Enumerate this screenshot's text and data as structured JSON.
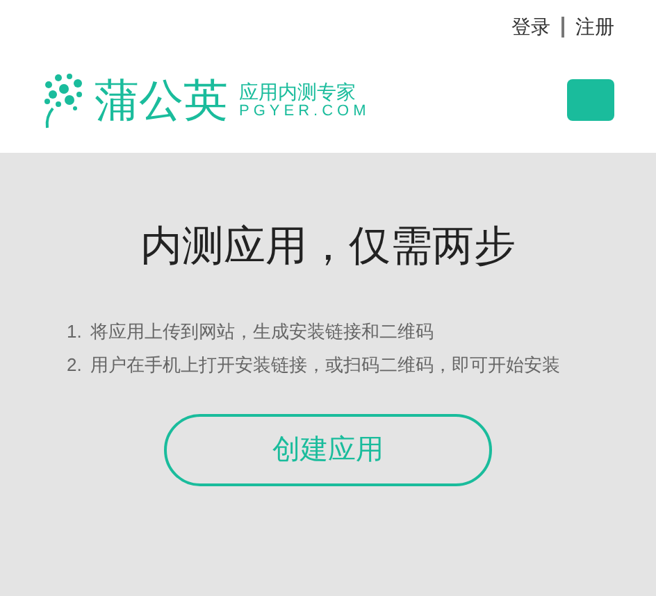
{
  "top_links": [
    "登录",
    "注册"
  ],
  "logo": {
    "name": "蒲公英",
    "tagline": "应用内测专家",
    "domain": "PGYER.COM"
  },
  "title": "内测应用，仅需两步",
  "steps": [
    {
      "number": "1.",
      "text": "将应用上传到网站，生成安装链接和二维码"
    },
    {
      "number": "2.",
      "text": "用户在手机上打开安装链接，或扫码二维码，即可开始安装"
    }
  ],
  "create_button": "创建应用"
}
